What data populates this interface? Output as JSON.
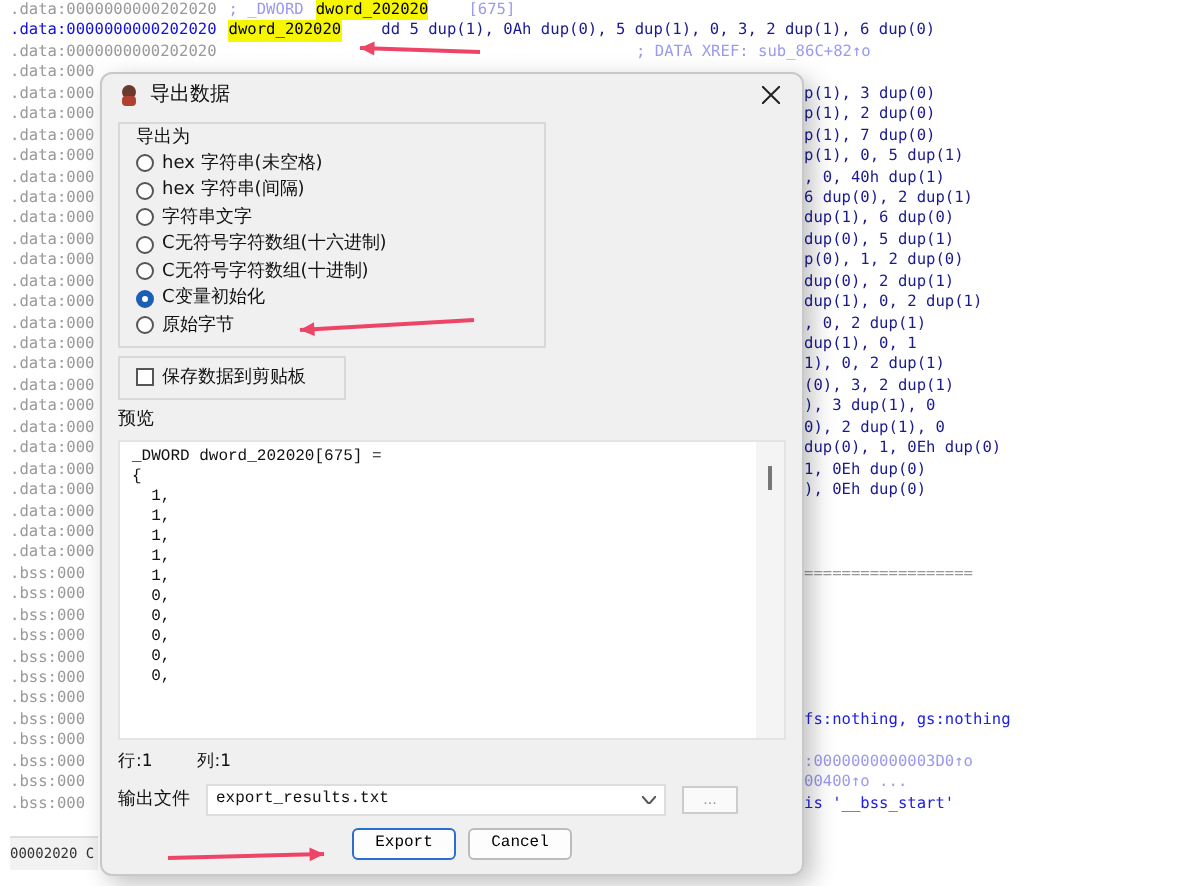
{
  "listing": {
    "rows": [
      {
        "address": ".data:0000000000202020",
        "current": false,
        "segments": [
          {
            "kind": "comment",
            "text": "; _DWORD"
          },
          {
            "kind": "name",
            "text": "dword_202020"
          },
          {
            "kind": "comment",
            "text": "[675]"
          }
        ]
      },
      {
        "address": ".data:0000000000202020",
        "current": true,
        "segments": [
          {
            "kind": "name",
            "text": "dword_202020"
          },
          {
            "kind": "code",
            "text": "dd 5 dup(1), 0Ah dup(0), 5 dup(1), 0, 3, 2 dup(1), 6 dup(0)"
          }
        ]
      },
      {
        "address": ".data:0000000000202020",
        "current": false,
        "segments": [
          {
            "kind": "xref",
            "text": "; DATA XREF: sub_86C+82↑o"
          }
        ]
      },
      {
        "address": ".data:000",
        "current": false,
        "segments": []
      },
      {
        "address": ".data:000",
        "current": false,
        "segments": [
          {
            "kind": "code",
            "text": "p(1), 3 dup(0)"
          }
        ]
      },
      {
        "address": ".data:000",
        "current": false,
        "segments": [
          {
            "kind": "code",
            "text": "p(1), 2 dup(0)"
          }
        ]
      },
      {
        "address": ".data:000",
        "current": false,
        "segments": [
          {
            "kind": "code",
            "text": "p(1), 7 dup(0)"
          }
        ]
      },
      {
        "address": ".data:000",
        "current": false,
        "segments": [
          {
            "kind": "code",
            "text": "p(1), 0, 5 dup(1)"
          }
        ]
      },
      {
        "address": ".data:000",
        "current": false,
        "segments": [
          {
            "kind": "code",
            "text": ", 0, 40h dup(1)"
          }
        ]
      },
      {
        "address": ".data:000",
        "current": false,
        "segments": [
          {
            "kind": "code",
            "text": "6 dup(0), 2 dup(1)"
          }
        ]
      },
      {
        "address": ".data:000",
        "current": false,
        "segments": [
          {
            "kind": "code",
            "text": "dup(1), 6 dup(0)"
          }
        ]
      },
      {
        "address": ".data:000",
        "current": false,
        "segments": [
          {
            "kind": "code",
            "text": "dup(0), 5 dup(1)"
          }
        ]
      },
      {
        "address": ".data:000",
        "current": false,
        "segments": [
          {
            "kind": "code",
            "text": "p(0), 1, 2 dup(0)"
          }
        ]
      },
      {
        "address": ".data:000",
        "current": false,
        "segments": [
          {
            "kind": "code",
            "text": "dup(0), 2 dup(1)"
          }
        ]
      },
      {
        "address": ".data:000",
        "current": false,
        "segments": [
          {
            "kind": "code",
            "text": "dup(1), 0, 2 dup(1)"
          }
        ]
      },
      {
        "address": ".data:000",
        "current": false,
        "segments": [
          {
            "kind": "code",
            "text": ", 0, 2 dup(1)"
          }
        ]
      },
      {
        "address": ".data:000",
        "current": false,
        "segments": [
          {
            "kind": "code",
            "text": "dup(1), 0, 1"
          }
        ]
      },
      {
        "address": ".data:000",
        "current": false,
        "segments": [
          {
            "kind": "code",
            "text": "1), 0, 2 dup(1)"
          }
        ]
      },
      {
        "address": ".data:000",
        "current": false,
        "segments": [
          {
            "kind": "code",
            "text": "(0), 3, 2 dup(1)"
          }
        ]
      },
      {
        "address": ".data:000",
        "current": false,
        "segments": [
          {
            "kind": "code",
            "text": "), 3 dup(1), 0"
          }
        ]
      },
      {
        "address": ".data:000",
        "current": false,
        "segments": [
          {
            "kind": "code",
            "text": "0), 2 dup(1), 0"
          }
        ]
      },
      {
        "address": ".data:000",
        "current": false,
        "segments": [
          {
            "kind": "code",
            "text": "dup(0), 1, 0Eh dup(0)"
          }
        ]
      },
      {
        "address": ".data:000",
        "current": false,
        "segments": [
          {
            "kind": "code",
            "text": "1, 0Eh dup(0)"
          }
        ]
      },
      {
        "address": ".data:000",
        "current": false,
        "segments": [
          {
            "kind": "code",
            "text": "), 0Eh dup(0)"
          }
        ]
      },
      {
        "address": ".data:000",
        "current": false,
        "segments": []
      },
      {
        "address": ".data:000",
        "current": false,
        "segments": []
      },
      {
        "address": ".data:000",
        "current": false,
        "segments": []
      },
      {
        "address": ".bss:000",
        "current": false,
        "segments": [
          {
            "kind": "rule",
            "text": "=================="
          }
        ]
      },
      {
        "address": ".bss:000",
        "current": false,
        "segments": []
      },
      {
        "address": ".bss:000",
        "current": false,
        "segments": []
      },
      {
        "address": ".bss:000",
        "current": false,
        "segments": []
      },
      {
        "address": ".bss:000",
        "current": false,
        "segments": []
      },
      {
        "address": ".bss:000",
        "current": false,
        "segments": []
      },
      {
        "address": ".bss:000",
        "current": false,
        "segments": []
      },
      {
        "address": ".bss:000",
        "current": false,
        "segments": [
          {
            "kind": "directive",
            "text": "fs:nothing, gs:nothing"
          }
        ]
      },
      {
        "address": ".bss:000",
        "current": false,
        "segments": []
      },
      {
        "address": ".bss:000",
        "current": false,
        "segments": [
          {
            "kind": "xref",
            "text": ":0000000000003D0↑o"
          }
        ]
      },
      {
        "address": ".bss:000",
        "current": false,
        "segments": [
          {
            "kind": "xref",
            "text": "00400↑o ..."
          }
        ]
      },
      {
        "address": ".bss:000",
        "current": false,
        "segments": [
          {
            "kind": "directive",
            "text": "is '__bss_start'"
          }
        ]
      }
    ]
  },
  "status_bar": {
    "text": "00002020 C"
  },
  "dialog": {
    "title": "导出数据",
    "export_as": {
      "label": "导出为",
      "options": [
        {
          "label": "hex 字符串(未空格)",
          "selected": false
        },
        {
          "label": "hex 字符串(间隔)",
          "selected": false
        },
        {
          "label": "字符串文字",
          "selected": false
        },
        {
          "label": "C无符号字符数组(十六进制)",
          "selected": false
        },
        {
          "label": "C无符号字符数组(十进制)",
          "selected": false
        },
        {
          "label": "C变量初始化",
          "selected": true
        },
        {
          "label": "原始字节",
          "selected": false
        }
      ]
    },
    "clipboard": {
      "label": "保存数据到剪贴板",
      "checked": false
    },
    "preview": {
      "label": "预览",
      "lines": [
        "_DWORD dword_202020[675] =",
        "{",
        "  1,",
        "  1,",
        "  1,",
        "  1,",
        "  1,",
        "  0,",
        "  0,",
        "  0,",
        "  0,",
        "  0,"
      ],
      "row": "行:1",
      "column": "列:1"
    },
    "output_file": {
      "label": "输出文件",
      "value": "export_results.txt",
      "browse": "..."
    },
    "buttons": [
      "Export",
      "Cancel"
    ]
  }
}
